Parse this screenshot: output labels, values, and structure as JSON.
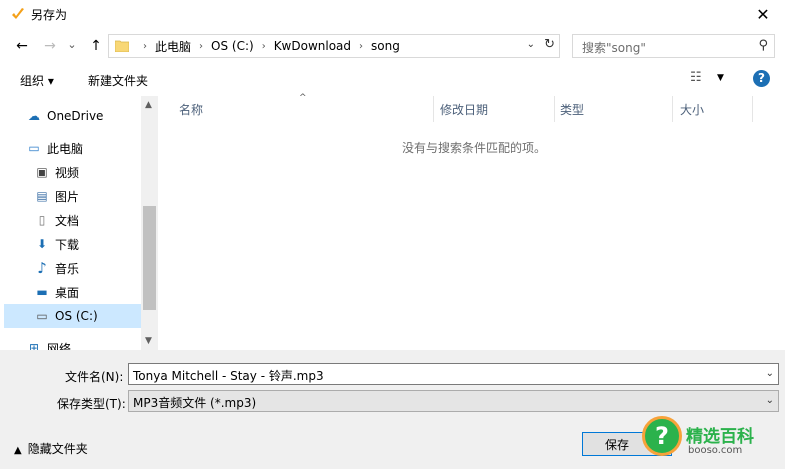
{
  "window": {
    "title": "另存为",
    "close_glyph": "✕"
  },
  "nav_buttons": {
    "back": "←",
    "forward": "→",
    "dropdown": "⌄",
    "up": "↑"
  },
  "address": {
    "crumbs": [
      "此电脑",
      "OS (C:)",
      "KwDownload",
      "song"
    ],
    "separator": "›",
    "dropdown_glyph": "⌄",
    "refresh_glyph": "↻"
  },
  "search": {
    "placeholder": "搜索\"song\"",
    "icon_glyph": "⚲"
  },
  "toolbar": {
    "organize": "组织 ▾",
    "new_folder": "新建文件夹",
    "view_glyph": "☷",
    "view_caret": "▼",
    "help": "?"
  },
  "navpane": {
    "items": [
      {
        "label": "OneDrive",
        "icon": "cloud-icon",
        "glyph": "☁",
        "color": "#1c6fb4"
      },
      {
        "label": "此电脑",
        "icon": "computer-icon",
        "glyph": "▭",
        "color": "#2a7bc9"
      },
      {
        "label": "视频",
        "icon": "video-icon",
        "glyph": "▣",
        "color": "#444444"
      },
      {
        "label": "图片",
        "icon": "picture-icon",
        "glyph": "▤",
        "color": "#3a6ea5"
      },
      {
        "label": "文档",
        "icon": "document-icon",
        "glyph": "▯",
        "color": "#777777"
      },
      {
        "label": "下载",
        "icon": "download-icon",
        "glyph": "⬇",
        "color": "#1c6fb4"
      },
      {
        "label": "音乐",
        "icon": "music-icon",
        "glyph": "♪",
        "color": "#1c6fb4"
      },
      {
        "label": "桌面",
        "icon": "desktop-icon",
        "glyph": "▬",
        "color": "#1c6fb4"
      },
      {
        "label": "OS (C:)",
        "icon": "drive-icon",
        "glyph": "▭",
        "color": "#555555",
        "selected": true
      },
      {
        "label": "网络",
        "icon": "network-icon",
        "glyph": "⊞",
        "color": "#1c6fb4"
      }
    ],
    "scroll_up": "▲",
    "scroll_down": "▼"
  },
  "list": {
    "columns": [
      "名称",
      "修改日期",
      "类型",
      "大小"
    ],
    "sort_glyph": "^",
    "empty_message": "没有与搜索条件匹配的项。"
  },
  "form": {
    "filename_label": "文件名(N):",
    "filename_value": "Tonya Mitchell - Stay - 铃声.mp3",
    "filetype_label": "保存类型(T):",
    "filetype_value": "MP3音频文件 (*.mp3)",
    "dropdown_glyph": "⌄"
  },
  "footer": {
    "hide_folders": "隐藏文件夹",
    "hide_caret": "▲",
    "save": "保存"
  },
  "watermark": {
    "glyph": "?",
    "title": "精选百科",
    "url": "booso.com"
  }
}
